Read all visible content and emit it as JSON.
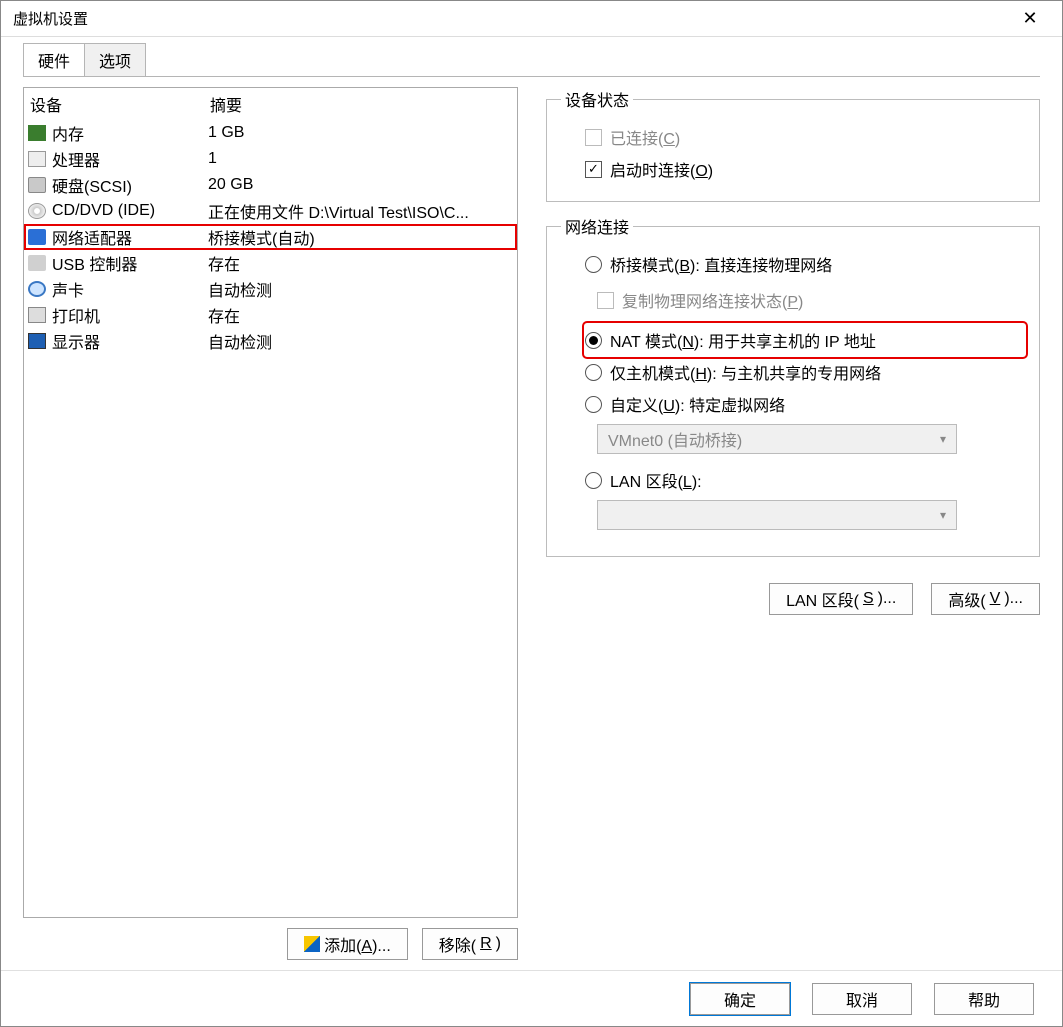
{
  "title": "虚拟机设置",
  "tabs": {
    "hardware": "硬件",
    "options": "选项"
  },
  "headers": {
    "device": "设备",
    "summary": "摘要"
  },
  "devices": [
    {
      "icon": "mem",
      "name": "内存",
      "summary": "1 GB"
    },
    {
      "icon": "cpu",
      "name": "处理器",
      "summary": "1"
    },
    {
      "icon": "hdd",
      "name": "硬盘(SCSI)",
      "summary": "20 GB"
    },
    {
      "icon": "cd",
      "name": "CD/DVD (IDE)",
      "summary": "正在使用文件 D:\\Virtual Test\\ISO\\C..."
    },
    {
      "icon": "net",
      "name": "网络适配器",
      "summary": "桥接模式(自动)",
      "selected": true
    },
    {
      "icon": "usb",
      "name": "USB 控制器",
      "summary": "存在"
    },
    {
      "icon": "snd",
      "name": "声卡",
      "summary": "自动检测"
    },
    {
      "icon": "prn",
      "name": "打印机",
      "summary": "存在"
    },
    {
      "icon": "disp",
      "name": "显示器",
      "summary": "自动检测"
    }
  ],
  "leftButtons": {
    "add": "添加(A)...",
    "remove": "移除(R)"
  },
  "stateGroup": {
    "legend": "设备状态",
    "connected": {
      "label": "已连接(C)",
      "checked": false,
      "disabled": true
    },
    "connectAtPowerOn": {
      "label": "启动时连接(O)",
      "checked": true
    }
  },
  "netGroup": {
    "legend": "网络连接",
    "bridged": {
      "label": "桥接模式(B): 直接连接物理网络"
    },
    "replicate": {
      "label": "复制物理网络连接状态(P)",
      "disabled": true
    },
    "nat": {
      "label": "NAT 模式(N): 用于共享主机的 IP 地址",
      "checked": true,
      "highlight": true
    },
    "hostonly": {
      "label": "仅主机模式(H): 与主机共享的专用网络"
    },
    "custom": {
      "label": "自定义(U): 特定虚拟网络"
    },
    "customCombo": "VMnet0 (自动桥接)",
    "lan": {
      "label": "LAN 区段(L):"
    },
    "lanCombo": "",
    "btnLan": "LAN 区段(S)...",
    "btnAdv": "高级(V)..."
  },
  "footer": {
    "ok": "确定",
    "cancel": "取消",
    "help": "帮助"
  }
}
